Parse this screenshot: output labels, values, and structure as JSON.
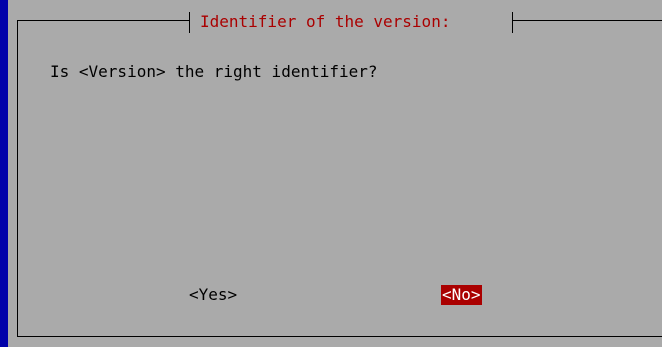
{
  "dialog": {
    "title": "Identifier of the version:",
    "message": "Is <Version> the right identifier?",
    "buttons": {
      "yes_label": "<Yes>",
      "no_label": "<No>"
    },
    "selected_button": "no"
  },
  "colors": {
    "background": "#0000aa",
    "dialog": "#aaaaaa",
    "title": "#aa0000",
    "selected_button_bg": "#aa0000",
    "selected_button_fg": "#ffffff"
  }
}
